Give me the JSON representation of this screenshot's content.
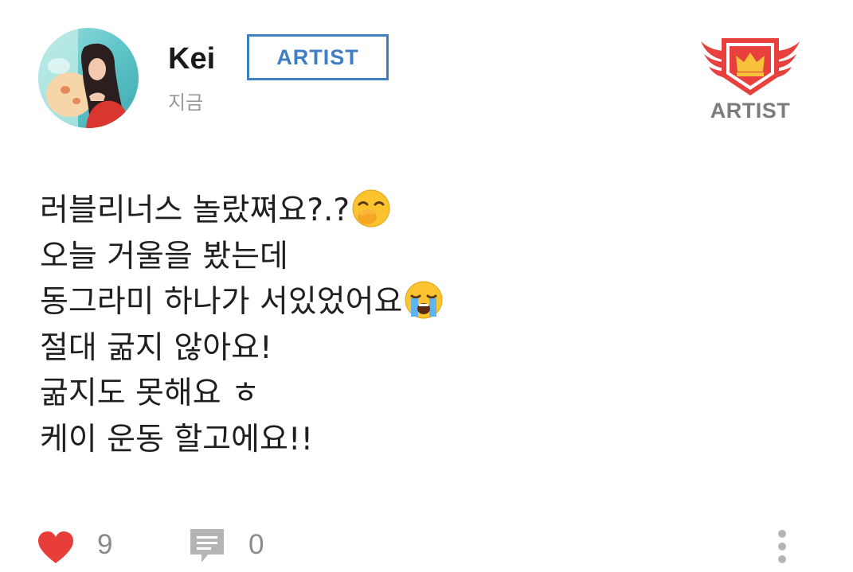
{
  "author": {
    "name": "Kei",
    "tag": "ARTIST",
    "timestamp": "지금"
  },
  "badge": {
    "label": "ARTIST",
    "icon": "crown-shield-wings-icon"
  },
  "post": {
    "lines": [
      {
        "text": "러블리너스 놀랐쪄요?.?",
        "emoji": "hand-over-mouth-emoji"
      },
      {
        "text": "오늘 거울을 봤는데",
        "emoji": null
      },
      {
        "text": "동그라미 하나가 서있었어요",
        "emoji": "crying-face-emoji"
      },
      {
        "text": "절대 굶지 않아요!",
        "emoji": null
      },
      {
        "text": "굶지도 못해요 ㅎ",
        "emoji": null
      },
      {
        "text": "케이 운동 할고에요!!",
        "emoji": null
      }
    ]
  },
  "footer": {
    "likes": "9",
    "comments": "0",
    "like_icon": "heart-icon",
    "comment_icon": "comment-icon",
    "more_icon": "more-vertical-icon"
  },
  "colors": {
    "accent_blue": "#3f7fc1",
    "badge_red": "#e8413d",
    "badge_gold": "#f7c23a",
    "heart_red": "#e83e3a",
    "muted_gray": "#8a8a8a"
  }
}
